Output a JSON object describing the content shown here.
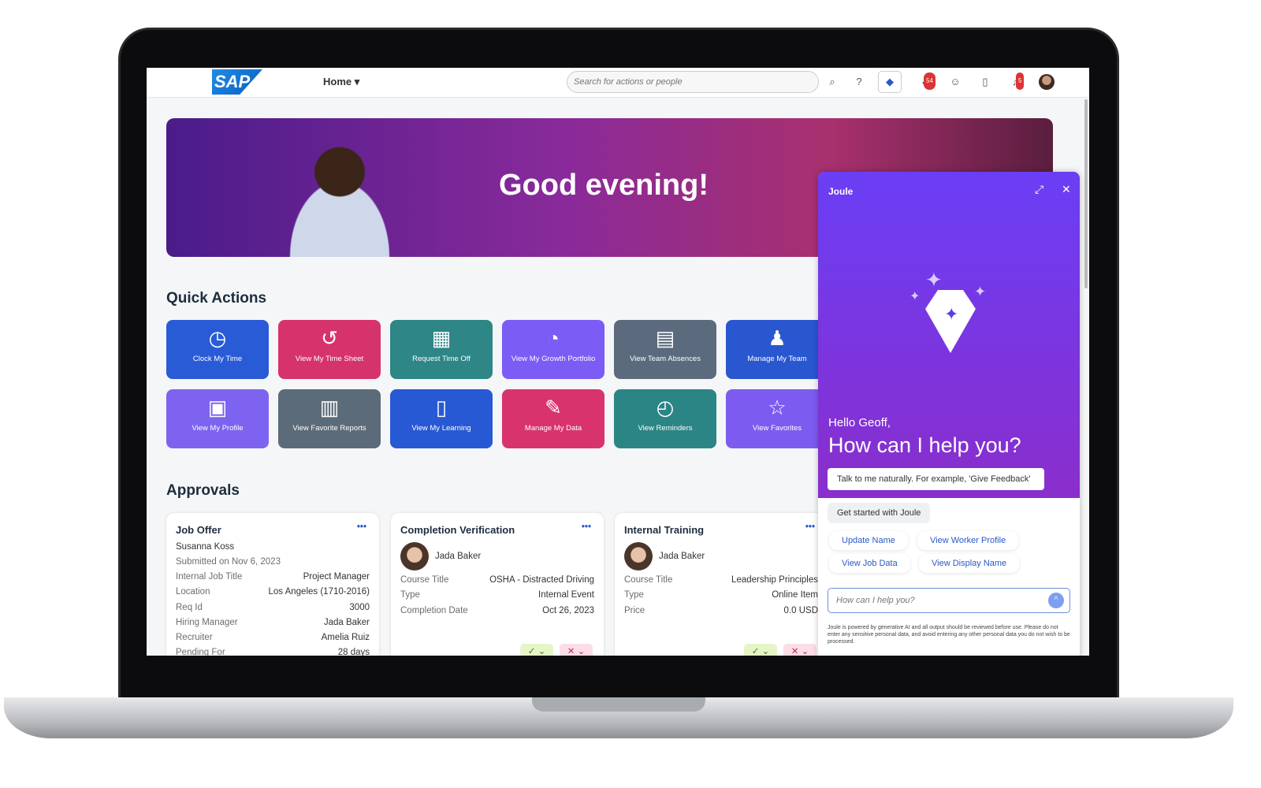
{
  "header": {
    "logo": "SAP",
    "home": "Home ▾",
    "search_placeholder": "Search for actions or people",
    "todo_badge": "54",
    "notif_badge": "5"
  },
  "banner": {
    "greeting": "Good evening!"
  },
  "quick_actions": {
    "title": "Quick Actions",
    "tiles": [
      {
        "label": "Clock My Time",
        "icon": "clock-plus-icon",
        "glyph": "◷",
        "color": "#2a5bd7"
      },
      {
        "label": "View My Time Sheet",
        "icon": "history-icon",
        "glyph": "↺",
        "color": "#d6336c"
      },
      {
        "label": "Request Time Off",
        "icon": "calendar-icon",
        "glyph": "▦",
        "color": "#2e8686"
      },
      {
        "label": "View My Growth Portfolio",
        "icon": "growth-icon",
        "glyph": "◔",
        "color": "#7b5cf5"
      },
      {
        "label": "View Team Absences",
        "icon": "calendar-icon",
        "glyph": "▤",
        "color": "#5b6b7d"
      },
      {
        "label": "Manage My Team",
        "icon": "org-chart-icon",
        "glyph": "♟",
        "color": "#2957d0"
      },
      {
        "label": "View My Profile",
        "icon": "id-card-icon",
        "glyph": "▣",
        "color": "#7e63f0"
      },
      {
        "label": "View Favorite Reports",
        "icon": "reports-icon",
        "glyph": "▥",
        "color": "#5c6b7a"
      },
      {
        "label": "View My Learning",
        "icon": "learning-icon",
        "glyph": "▯",
        "color": "#2859d4"
      },
      {
        "label": "Manage My Data",
        "icon": "user-edit-icon",
        "glyph": "✎",
        "color": "#d8336d"
      },
      {
        "label": "View Reminders",
        "icon": "reminder-icon",
        "glyph": "◴",
        "color": "#2b8585"
      },
      {
        "label": "View Favorites",
        "icon": "star-icon",
        "glyph": "☆",
        "color": "#7c5cf0"
      }
    ]
  },
  "approvals": {
    "title": "Approvals",
    "cards": [
      {
        "title": "Job Offer",
        "name": "Susanna Koss",
        "submitted": "Submitted on Nov 6, 2023",
        "rows": [
          [
            "Internal Job Title",
            "Project Manager"
          ],
          [
            "Location",
            "Los Angeles (1710-2016)"
          ],
          [
            "Req Id",
            "3000"
          ],
          [
            "Hiring Manager",
            "Jada Baker"
          ],
          [
            "Recruiter",
            "Amelia Ruiz"
          ],
          [
            "Pending For",
            "28 days"
          ]
        ]
      },
      {
        "title": "Completion Verification",
        "person": "Jada Baker",
        "rows": [
          [
            "Course Title",
            "OSHA - Distracted Driving"
          ],
          [
            "Type",
            "Internal Event"
          ],
          [
            "Completion Date",
            "Oct 26, 2023"
          ]
        ],
        "approve": "✓ ⌄",
        "reject": "✕ ⌄"
      },
      {
        "title": "Internal Training",
        "person": "Jada Baker",
        "rows": [
          [
            "Course Title",
            "Leadership Principles"
          ],
          [
            "Type",
            "Online Item"
          ],
          [
            "Price",
            "0.0 USD"
          ]
        ],
        "approve": "✓ ⌄",
        "reject": "✕ ⌄"
      }
    ]
  },
  "joule": {
    "title": "Joule",
    "hello": "Hello Geoff,",
    "help": "How can I help  you?",
    "hint": "Talk to me naturally. For example, 'Give Feedback'",
    "get_started": "Get started with Joule",
    "chips": [
      "Update Name",
      "View Worker Profile",
      "View Job Data",
      "View Display Name"
    ],
    "input_placeholder": "How can I help you?",
    "disclaimer": "Joule is powered by generative AI and all output should be reviewed before use. Please do not enter any sensitive personal data, and avoid entering any other personal data you do not wish to be processed."
  }
}
